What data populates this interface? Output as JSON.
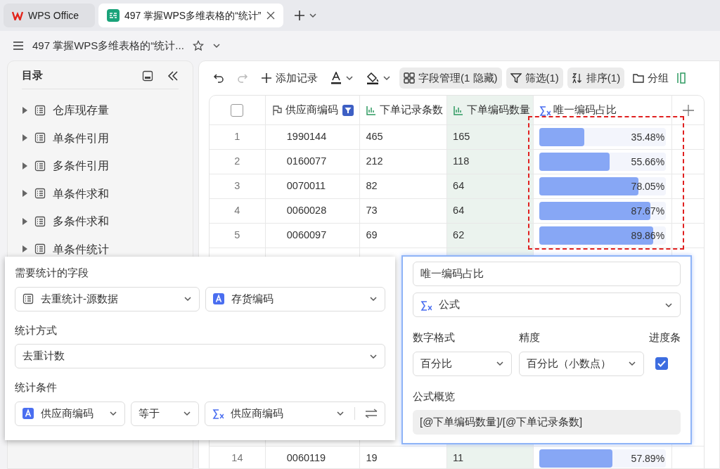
{
  "tabs": [
    {
      "label": "WPS Office",
      "kind": "home",
      "selected": false
    },
    {
      "label": "497 掌握WPS多维表格的“统计”",
      "kind": "doc",
      "selected": true
    }
  ],
  "doc_title": "497 掌握WPS多维表格的“统计...",
  "sidebar": {
    "title": "目录",
    "items": [
      {
        "label": "仓库现存量",
        "expanded": false
      },
      {
        "label": "单条件引用",
        "expanded": false
      },
      {
        "label": "多条件引用",
        "expanded": false
      },
      {
        "label": "单条件求和",
        "expanded": false
      },
      {
        "label": "多条件求和",
        "expanded": false
      },
      {
        "label": "单条件统计",
        "expanded": false
      }
    ]
  },
  "toolbar": [
    {
      "kind": "undo",
      "disabled": false
    },
    {
      "kind": "redo",
      "disabled": true
    },
    {
      "kind": "add",
      "label": "添加记录",
      "active": false
    },
    {
      "kind": "text-color"
    },
    {
      "kind": "fill"
    },
    {
      "kind": "fields",
      "label": "字段管理(1 隐藏)",
      "active": true
    },
    {
      "kind": "filter",
      "label": "筛选(1)",
      "active": true
    },
    {
      "kind": "sort",
      "label": "排序(1)",
      "active": true
    },
    {
      "kind": "group",
      "label": "分组",
      "active": false
    }
  ],
  "table": {
    "select_all": {
      "checked": false
    },
    "columns": [
      {
        "label": "供应商编码",
        "kind": "flag",
        "filtered": true,
        "selected": false
      },
      {
        "label": "下单记录条数",
        "kind": "stat",
        "filtered": false,
        "selected": false
      },
      {
        "label": "下单编码数量",
        "kind": "stat",
        "filtered": false,
        "selected": true
      },
      {
        "label": "唯一编码占比",
        "kind": "formula",
        "filtered": false,
        "selected": false
      }
    ],
    "rows": [
      {
        "index": "1",
        "cells": [
          "1990144",
          "465",
          "165"
        ],
        "ratio": {
          "level": 0.3548,
          "reading": "35.48%"
        }
      },
      {
        "index": "2",
        "cells": [
          "0160077",
          "212",
          "118"
        ],
        "ratio": {
          "level": 0.5566,
          "reading": "55.66%"
        }
      },
      {
        "index": "3",
        "cells": [
          "0070011",
          "82",
          "64"
        ],
        "ratio": {
          "level": 0.7805,
          "reading": "78.05%"
        }
      },
      {
        "index": "4",
        "cells": [
          "0060028",
          "73",
          "64"
        ],
        "ratio": {
          "level": 0.8767,
          "reading": "87.67%"
        }
      },
      {
        "index": "5",
        "cells": [
          "0060097",
          "69",
          "62"
        ],
        "ratio": {
          "level": 0.8986,
          "reading": "89.86%"
        }
      }
    ],
    "rows_after_gap": [
      {
        "index": "14",
        "cells": [
          "0060119",
          "19",
          "11"
        ],
        "ratio": {
          "level": 0.5789,
          "reading": "57.89%"
        }
      }
    ]
  },
  "stat_panel": {
    "field_label": "需要统计的字段",
    "source_table": "去重统计-源数据",
    "source_field": "存货编码",
    "method_label": "统计方式",
    "method": "去重计数",
    "condition_label": "统计条件",
    "condition": {
      "field": "供应商编码",
      "operator": "等于",
      "value": "供应商编码"
    }
  },
  "field_panel": {
    "name": "唯一编码占比",
    "type": "公式",
    "format_label": "数字格式",
    "format": "百分比",
    "precision_label": "精度",
    "precision": "百分比（小数点）",
    "progress_label": "进度条",
    "progress_bar": true,
    "preview_label": "公式概览",
    "formula": "[@下单编码数量]/[@下单记录条数]"
  }
}
